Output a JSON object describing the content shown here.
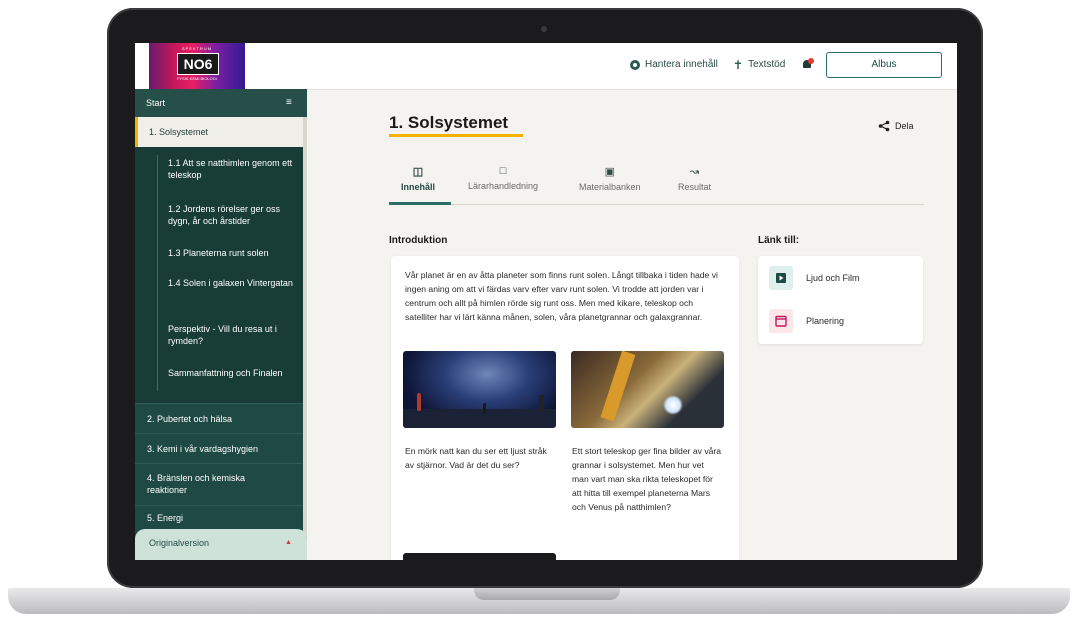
{
  "header": {
    "logo": {
      "top_text": "SPEKTRUM",
      "main_text": "NO6",
      "bottom_text": "FYSIK KEMI BIOLOGI"
    },
    "manage_label": "Hantera innehåll",
    "textstod_label": "Textstöd",
    "user_label": "Albus",
    "icons": {
      "manage": "gear-icon",
      "textstod": "person-icon",
      "notifications": "bell-icon"
    }
  },
  "sidebar": {
    "start_label": "Start",
    "active_label": "1. Solsystemet",
    "sub_items": [
      {
        "label": "1.1 Att se natthimlen genom ett teleskop"
      },
      {
        "label": "1.2 Jordens rörelser ger oss dygn, år och årstider"
      },
      {
        "label": "1.3 Planeterna runt solen"
      },
      {
        "label": "1.4 Solen i galaxen Vintergatan"
      },
      {
        "label": "Perspektiv - Vill du resa ut i rymden?"
      },
      {
        "label": "Sammanfattning och Finalen"
      }
    ],
    "chapters": [
      {
        "label": "2. Pubertet och hälsa"
      },
      {
        "label": "3. Kemi i vår vardagshygien"
      },
      {
        "label": "4. Bränslen och kemiska reaktioner"
      },
      {
        "label": "5. Energi"
      }
    ],
    "original_label": "Originalversion"
  },
  "main": {
    "title": "1. Solsystemet",
    "share_label": "Dela",
    "tabs": [
      {
        "label": "Innehåll",
        "icon": "book-icon"
      },
      {
        "label": "Lärarhandledning",
        "icon": "presentation-icon"
      },
      {
        "label": "Materialbanken",
        "icon": "folder-icon"
      },
      {
        "label": "Resultat",
        "icon": "chart-icon"
      }
    ],
    "intro_heading": "Introduktion",
    "intro_text": "Vår planet är en av åtta planeter som finns runt solen. Långt tillbaka i tiden hade vi ingen aning om att vi färdas varv efter varv runt solen. Vi trodde att jorden var i centrum och allt på himlen rörde sig runt oss. Men med kikare, teleskop och satelliter har vi lärt känna månen, solen, våra planetgrannar och galaxgrannar.",
    "captions": [
      "En mörk natt kan du ser ett ljust stråk av stjärnor. Vad är det du ser?",
      "Ett stort teleskop ger fina bilder av våra grannar i solsystemet. Men hur vet man vart man ska rikta teleskopet för att hitta till exempel planeterna Mars och Venus på natthimlen?"
    ],
    "link_heading": "Länk till:",
    "links": [
      {
        "label": "Ljud och Film",
        "icon": "play-icon",
        "color": "#dff0ec"
      },
      {
        "label": "Planering",
        "icon": "calendar-icon",
        "color": "#fbe6ea"
      }
    ]
  },
  "colors": {
    "accent": "#f5b300",
    "sidebar": "#1f4a43",
    "teal": "#2c6e66"
  }
}
